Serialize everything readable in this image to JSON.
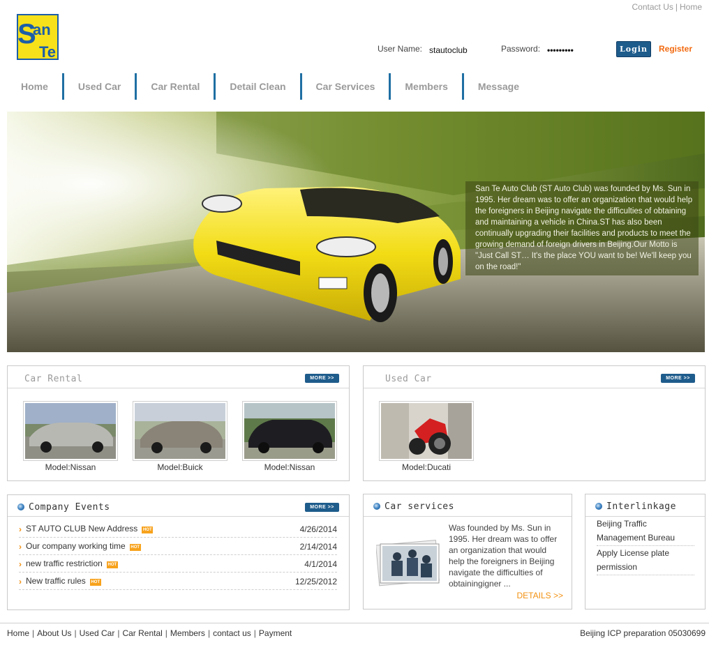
{
  "top_links": {
    "contact": "Contact Us",
    "separator": "|",
    "home": "Home"
  },
  "logo": {
    "text_top": "San",
    "text_bottom": "Te",
    "colors": {
      "blue": "#1c5ea8",
      "yellow": "#f7e11a"
    }
  },
  "login": {
    "username_label": "User Name:",
    "username_value": "stautoclub",
    "password_label": "Password:",
    "password_value": "•••••••••",
    "login_button": "Login",
    "register_link": "Register"
  },
  "nav": [
    "Home",
    "Used Car",
    "Car Rental",
    "Detail Clean",
    "Car Services",
    "Members",
    "Message"
  ],
  "banner": {
    "caption": "San Te Auto Club (ST Auto Club) was founded by Ms. Sun in 1995. Her dream was to offer an organization that would help the foreigners in Beijing navigate the difficulties of obtaining and maintaining a vehicle in China.ST has also been continually upgrading their facilities and products to meet the growing demand of foreign drivers in Beijing.Our Motto is \"Just Call ST… It's the place YOU want to be! We'll keep you on the road!\""
  },
  "car_rental": {
    "title": "Car Rental",
    "more": "MORE >>",
    "items": [
      {
        "caption": "Model:Nissan",
        "car_color": "#b8b8b2"
      },
      {
        "caption": "Model:Buick",
        "car_color": "#8a8478"
      },
      {
        "caption": "Model:Nissan",
        "car_color": "#1e1e22"
      }
    ]
  },
  "used_car": {
    "title": "Used Car",
    "more": "MORE >>",
    "items": [
      {
        "caption": "Model:Ducati"
      }
    ]
  },
  "company_events": {
    "title": "Company Events",
    "more": "MORE >>",
    "hot_label": "HOT",
    "items": [
      {
        "title": "ST AUTO CLUB New Address",
        "date": "4/26/2014"
      },
      {
        "title": "Our company working time",
        "date": "2/14/2014"
      },
      {
        "title": "new traffic restriction",
        "date": "4/1/2014"
      },
      {
        "title": "New traffic rules",
        "date": "12/25/2012"
      }
    ]
  },
  "car_services": {
    "title": "Car services",
    "text": "Was founded by Ms. Sun in 1995. Her dream was to offer an organization that would help the foreigners in Beijing navigate the difficulties of obtainingigner ...",
    "details": "DETAILS >>"
  },
  "interlinkage": {
    "title": "Interlinkage",
    "links": [
      "Beijing Traffic Management Bureau",
      "Apply License plate permission"
    ]
  },
  "footer": {
    "links": [
      "Home",
      "About Us",
      "Used Car",
      "Car Rental",
      "Members",
      "contact us",
      "Payment"
    ],
    "separator": "|",
    "icp": "Beijing ICP preparation 05030699"
  }
}
